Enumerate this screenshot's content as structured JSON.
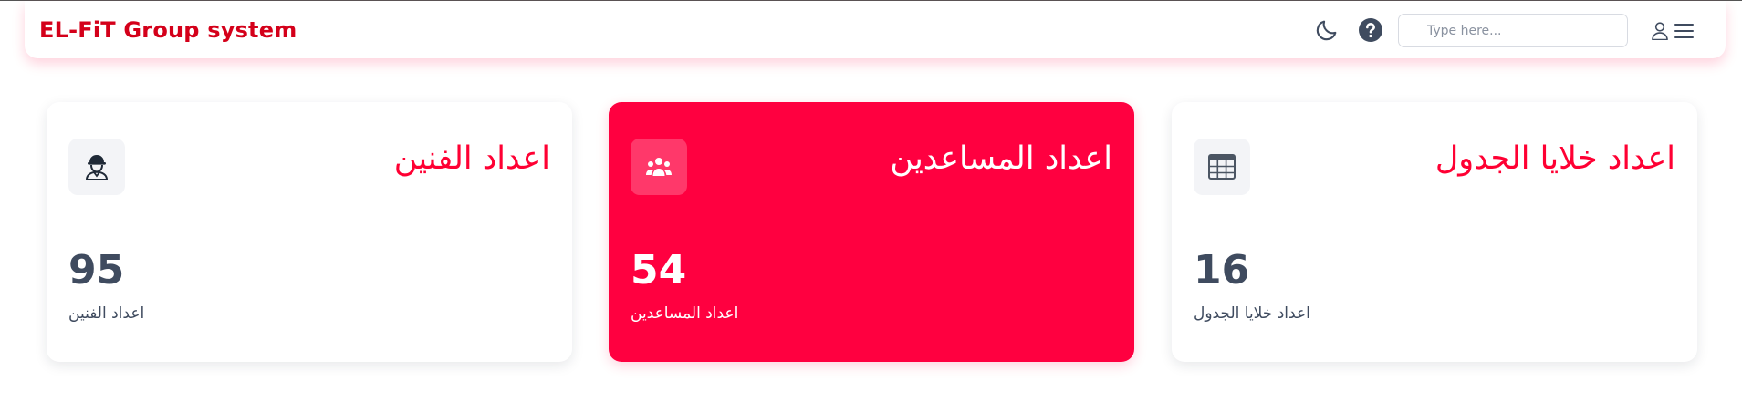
{
  "header": {
    "brand": "EL-FiT Group system",
    "search": {
      "placeholder": "Type here...",
      "value": ""
    },
    "icons": {
      "theme": "moon-icon",
      "help": "question-circle-icon",
      "user": "user-icon",
      "menu": "hamburger-menu-icon"
    }
  },
  "cards": [
    {
      "title": "اعداد الفنين",
      "value": "95",
      "subtitle": "اعداد الفنين",
      "icon": "technician-icon",
      "highlighted": false
    },
    {
      "title": "اعداد المساعدين",
      "value": "54",
      "subtitle": "اعداد المساعدين",
      "icon": "users-group-icon",
      "highlighted": true
    },
    {
      "title": "اعداد خلايا الجدول",
      "value": "16",
      "subtitle": "اعداد خلايا الجدول",
      "icon": "table-grid-icon",
      "highlighted": false
    }
  ],
  "colors": {
    "brand": "#d4001a",
    "accent": "#ff0040",
    "text_dark": "#3f4b5f"
  }
}
